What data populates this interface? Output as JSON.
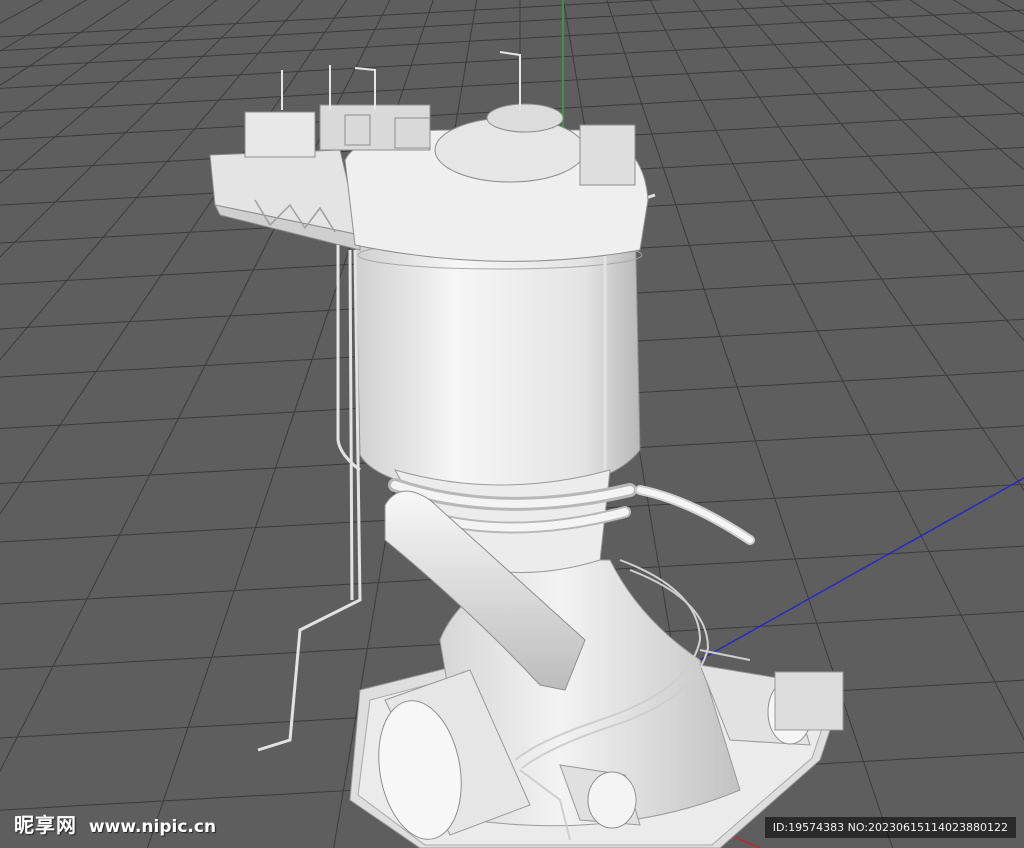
{
  "watermark": {
    "brand": "昵享网",
    "url": "www.nipic.cn"
  },
  "image_id": "ID:19574383 NO:20230615114023880122",
  "colors": {
    "background": "#5e5e5e",
    "grid_line": "#3c3c3c",
    "model_light": "#f4f4f4",
    "model_shadow": "#bdbdbd",
    "axis_y": "#2fae2f",
    "axis_x": "#2a2abf",
    "axis_z": "#c02a2a"
  }
}
